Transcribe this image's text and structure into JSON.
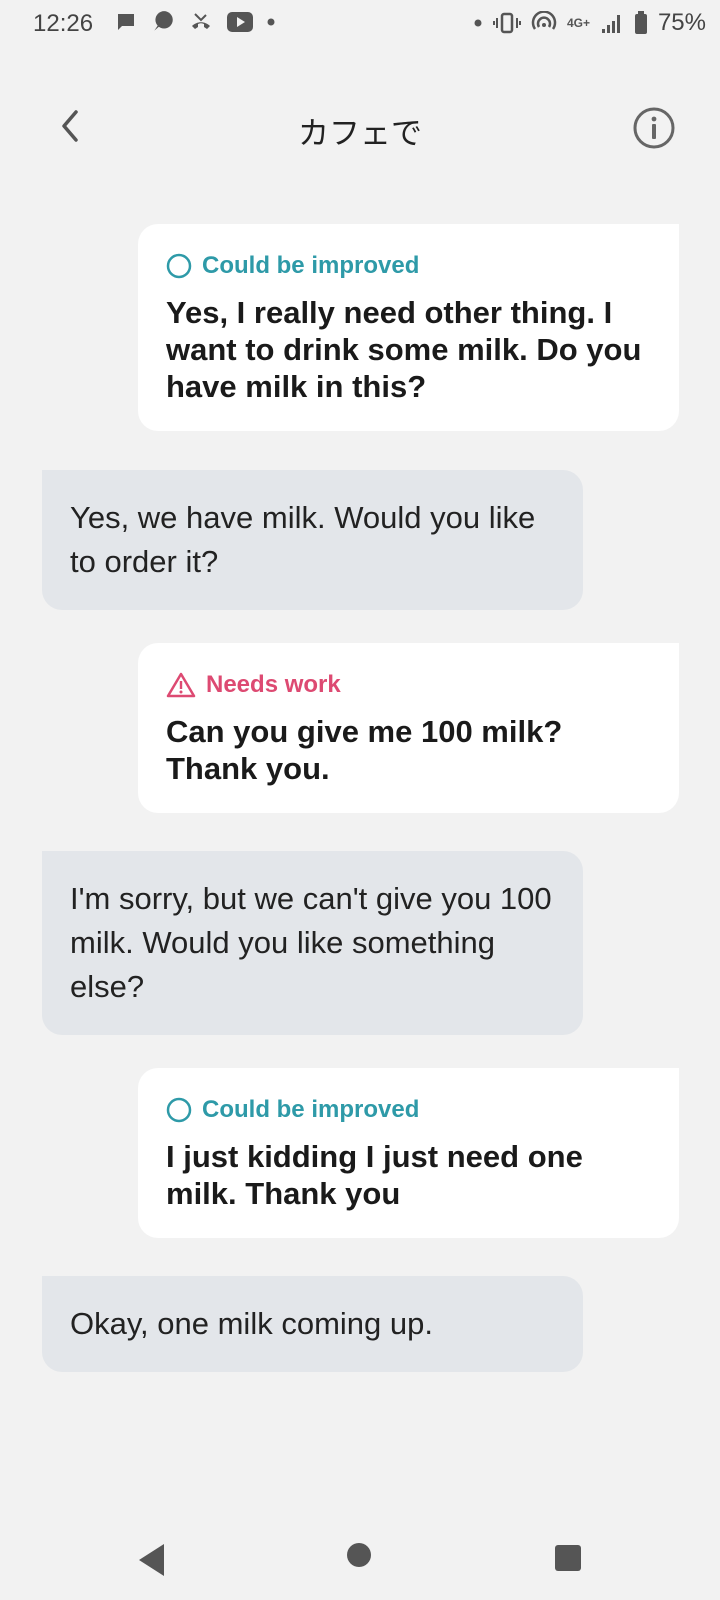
{
  "status_bar": {
    "time": "12:26",
    "network": "4G+",
    "battery": "75%"
  },
  "header": {
    "title": "カフェで"
  },
  "messages": [
    {
      "role": "user",
      "feedback": "Could be improved",
      "feedback_type": "improve",
      "text": "Yes, I really need other thing. I want to drink some milk. Do you have milk in this?"
    },
    {
      "role": "bot",
      "text": "Yes, we have milk. Would you like to order it?"
    },
    {
      "role": "user",
      "feedback": "Needs work",
      "feedback_type": "work",
      "text": "Can you give me 100 milk? Thank you."
    },
    {
      "role": "bot",
      "text": "I'm sorry, but we can't give you 100 milk. Would you like something else?"
    },
    {
      "role": "user",
      "feedback": "Could be improved",
      "feedback_type": "improve",
      "text": "I just kidding I just need one milk. Thank you"
    },
    {
      "role": "bot",
      "text": "Okay, one milk coming up."
    }
  ],
  "colors": {
    "improve": "#2e9aa8",
    "needs_work": "#dd4a72",
    "bot_bubble": "#e3e6ea",
    "user_bubble": "#ffffff",
    "background": "#f2f2f2"
  },
  "icons": {
    "back": "chevron-left-icon",
    "info": "info-icon",
    "improve": "circle-icon",
    "needs_work": "warning-triangle-icon"
  }
}
